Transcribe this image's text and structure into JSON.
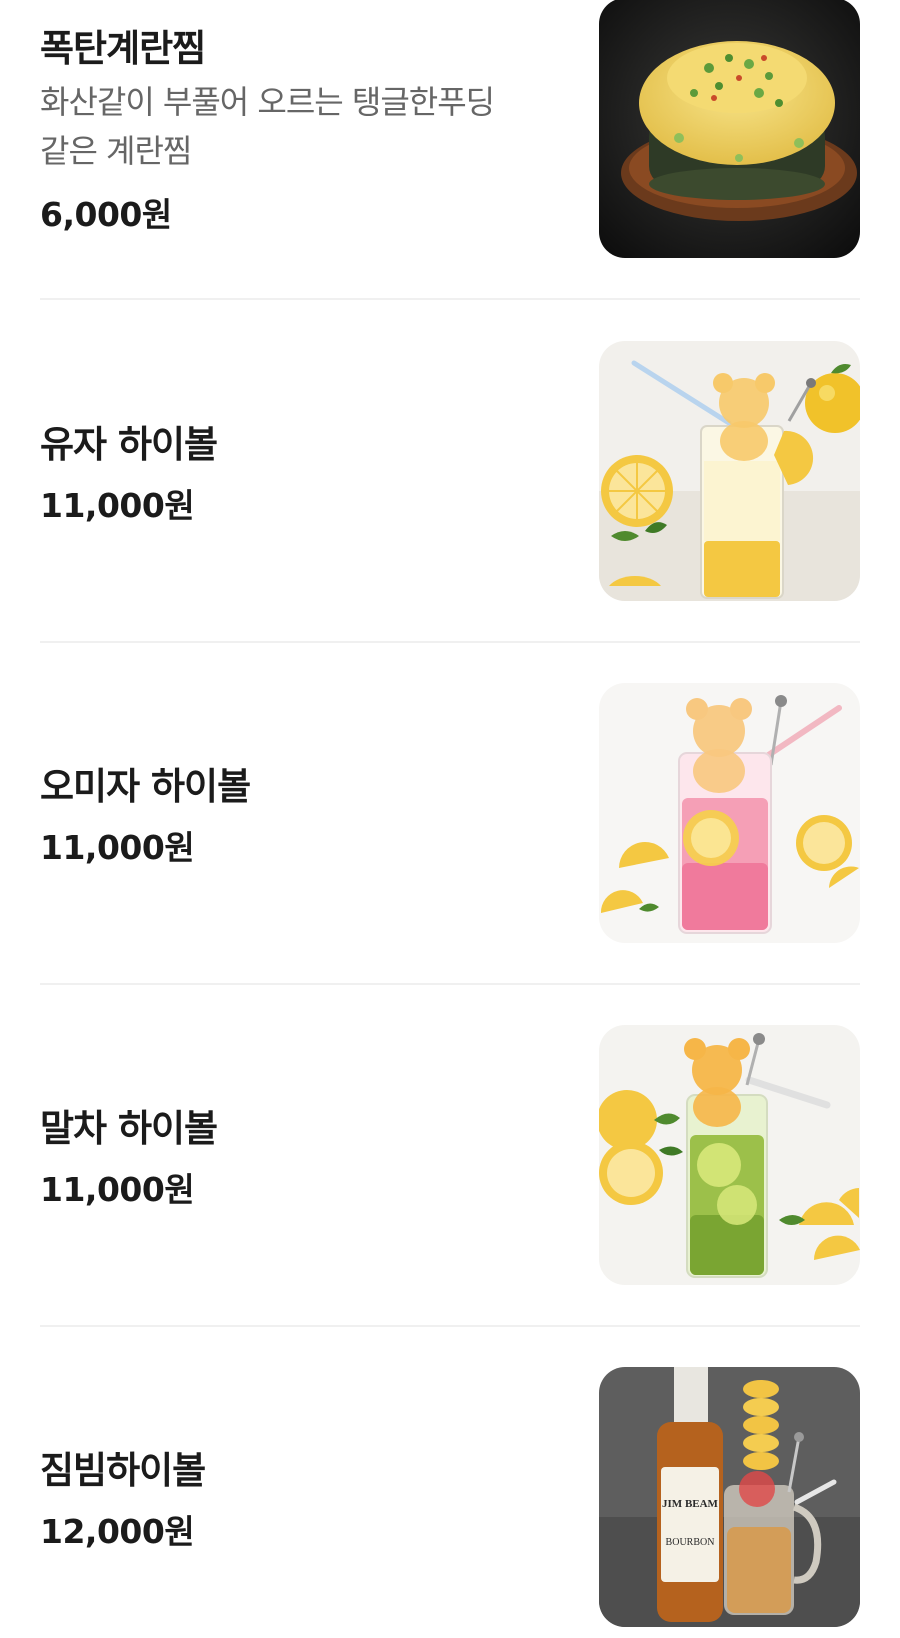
{
  "menu": {
    "items": [
      {
        "name": "폭탄계란찜",
        "description_line1": "화산같이 부풀어 오르는 탱글한푸딩",
        "description_line2": "같은 계란찜",
        "price": "6,000원",
        "photo_icon": "steamed-egg-photo"
      },
      {
        "name": "유자 하이볼",
        "price": "11,000원",
        "photo_icon": "yuja-highball-photo"
      },
      {
        "name": "오미자 하이볼",
        "price": "11,000원",
        "photo_icon": "omija-highball-photo"
      },
      {
        "name": "말차 하이볼",
        "price": "11,000원",
        "photo_icon": "matcha-highball-photo"
      },
      {
        "name": "짐빔하이볼",
        "price": "12,000원",
        "photo_icon": "jimbeam-highball-photo",
        "bottle_label_line1": "JIM BEAM",
        "bottle_label_line2": "BOURBON"
      }
    ]
  }
}
